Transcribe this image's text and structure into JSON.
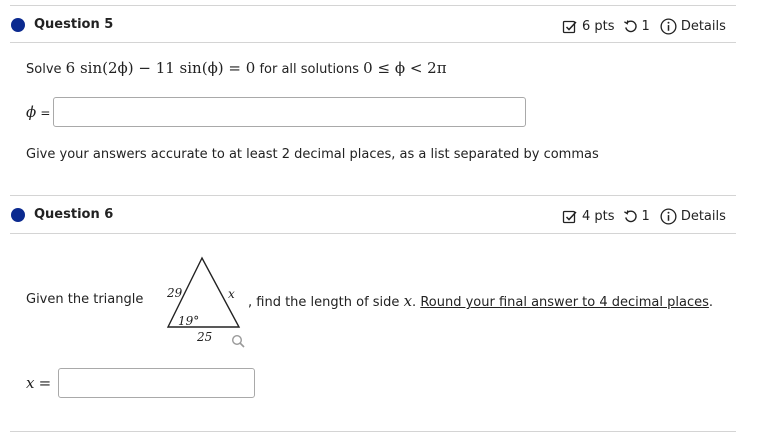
{
  "q5": {
    "title": "Question 5",
    "points": "6 pts",
    "attempts": "1",
    "details": "Details",
    "solve_word": "Solve",
    "equation": "6 sin(2ϕ) − 11 sin(ϕ) = 0",
    "for_all": "for all solutions",
    "range": "0 ≤ ϕ < 2π",
    "answer_label": "ϕ",
    "equals": "=",
    "answer_value": "",
    "instructions": "Give your answers accurate to at least 2 decimal places, as a list separated by commas"
  },
  "q6": {
    "title": "Question 6",
    "points": "4 pts",
    "attempts": "1",
    "details": "Details",
    "given": "Given the triangle",
    "triangle": {
      "left_side": "29",
      "angle": "19°",
      "base": "25",
      "unknown": "x"
    },
    "find_prefix": ", find the length of side",
    "find_var": "x",
    "round_text": "Round your final answer to 4 decimal places",
    "period": ".",
    "answer_label": "x",
    "equals": "=",
    "answer_value": ""
  },
  "colors": {
    "dot": "#0b2a8f",
    "divider": "#d4d4d4"
  }
}
